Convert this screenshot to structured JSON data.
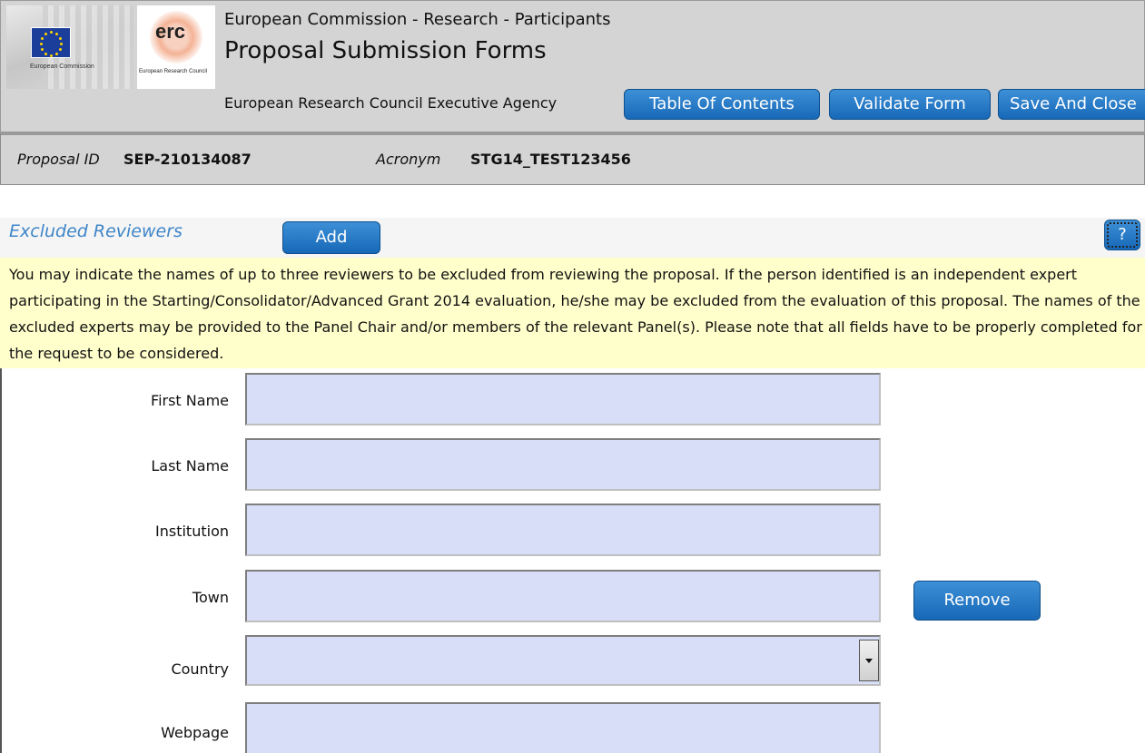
{
  "header": {
    "ec_logo_text": "European Commission",
    "erc_logo_word": "erc",
    "erc_logo_subtitle": "European Research Council",
    "subtitle": "European Commission - Research - Participants",
    "title": "Proposal Submission Forms",
    "agency": "European Research Council Executive Agency",
    "buttons": {
      "toc": "Table Of Contents",
      "validate": "Validate Form",
      "save_close": "Save And Close"
    }
  },
  "proposal": {
    "id_label": "Proposal ID",
    "id_value": "SEP-210134087",
    "acronym_label": "Acronym",
    "acronym_value": "STG14_TEST123456"
  },
  "section": {
    "title": "Excluded Reviewers",
    "add_label": "Add",
    "help_label": "?",
    "notice": "You may indicate the names of up to three reviewers to be excluded from reviewing the proposal. If the person identified is an independent expert participating in the Starting/Consolidator/Advanced Grant 2014 evaluation, he/she may be excluded from the evaluation of this proposal. The names of the excluded experts may be provided to the Panel Chair and/or members of the relevant Panel(s). Please note that all fields have to be properly completed for the request to be considered."
  },
  "form": {
    "first_name_label": "First Name",
    "last_name_label": "Last Name",
    "institution_label": "Institution",
    "town_label": "Town",
    "country_label": "Country",
    "webpage_label": "Webpage",
    "first_name_value": "",
    "last_name_value": "",
    "institution_value": "",
    "town_value": "",
    "country_value": "",
    "webpage_value": "",
    "remove_label": "Remove"
  },
  "colors": {
    "button_blue": "#1769b8",
    "section_title": "#3f86c8",
    "notice_bg": "#ffffcc",
    "field_bg": "#d8ddf8",
    "header_bg": "#d4d4d4"
  }
}
